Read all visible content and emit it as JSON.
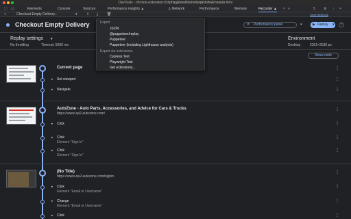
{
  "window": {
    "title": "DevTools - chrome-extension://chphlpgkkbolifaimnlloiipkdnihall/onetab.html"
  },
  "tabs": [
    {
      "label": "Elements"
    },
    {
      "label": "Console"
    },
    {
      "label": "Sources"
    },
    {
      "label": "Performance insights ▲"
    },
    {
      "label": "⚠ Network"
    },
    {
      "label": "Performance"
    },
    {
      "label": "Memory"
    },
    {
      "label": "Recorder ▲"
    }
  ],
  "tabbar": {
    "error_count": "5",
    "send_feedback": "Send feedback"
  },
  "toolbar": {
    "new": "+",
    "recording_select": "Checkout Empty Delivery...",
    "dropdown": "▾",
    "upload": "⇪",
    "download": "⤓",
    "delete": "🗑"
  },
  "header": {
    "title": "Checkout Empty Delivery",
    "perf_panel": "Performance panel",
    "replay": "Replay",
    "help": "?"
  },
  "settings": {
    "replay_title": "Replay settings",
    "throttling": "No throttling",
    "timeout": "Timeout: 5000 ms",
    "env_title": "Environment",
    "env_value": "Desktop",
    "env_size": "2361×2530 px"
  },
  "show_code": "Show code",
  "sections": [
    {
      "title": "Current page",
      "url": "",
      "steps": [
        {
          "label": "Set viewport",
          "sub": ""
        },
        {
          "label": "Navigate",
          "sub": ""
        }
      ]
    },
    {
      "title": "AutoZone - Auto Parts, Accessories, and Advice for Cars & Trucks",
      "url": "https://www-qa2.autozone.com/",
      "steps": [
        {
          "label": "Click",
          "sub": ""
        },
        {
          "label": "Click",
          "sub": "Element \"Sign In\""
        },
        {
          "label": "Click",
          "sub": "Element \"Sign In\""
        }
      ]
    },
    {
      "title": "(No Title)",
      "url": "https://www-qa2.autozone.com/signin",
      "steps": [
        {
          "label": "Click",
          "sub": "Element \"Email or Username\""
        },
        {
          "label": "Change",
          "sub": "Element \"Email or Username\""
        },
        {
          "label": "Click",
          "sub": ""
        }
      ]
    }
  ],
  "export_menu": {
    "heading1": "Export",
    "items1": [
      "JSON",
      "@puppeteer/replay",
      "Puppeteer",
      "Puppeteer (including Lighthouse analysis)"
    ],
    "heading2": "Export via extensions",
    "items2": [
      "Cypress Test",
      "Playwright Test",
      "Get extensions..."
    ]
  },
  "colors": {
    "accent": "#8ab4f8",
    "background": "#202124",
    "error": "#f28b82"
  }
}
